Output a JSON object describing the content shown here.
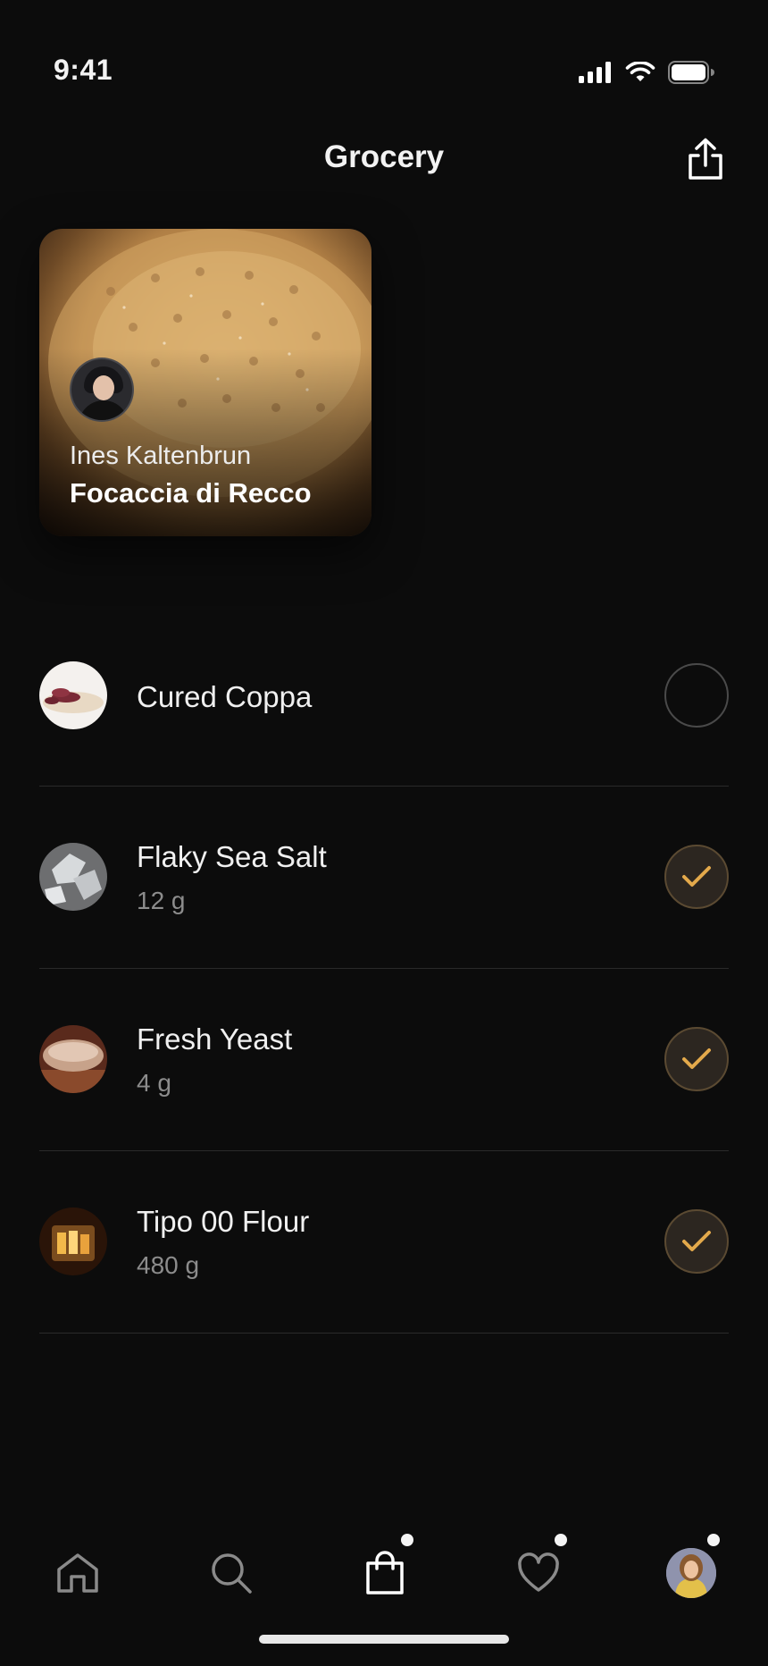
{
  "status_bar": {
    "time": "9:41"
  },
  "header": {
    "title": "Grocery"
  },
  "recipe": {
    "author": "Ines Kaltenbrun",
    "title": "Focaccia di Recco"
  },
  "items": [
    {
      "name": "Cured Coppa",
      "qty": "",
      "checked": false
    },
    {
      "name": "Flaky Sea Salt",
      "qty": "12 g",
      "checked": true
    },
    {
      "name": "Fresh Yeast",
      "qty": "4 g",
      "checked": true
    },
    {
      "name": "Tipo 00 Flour",
      "qty": "480 g",
      "checked": true
    }
  ],
  "tab_bar": {
    "tabs": [
      {
        "icon": "home-icon",
        "badge": false,
        "active": false
      },
      {
        "icon": "search-icon",
        "badge": false,
        "active": false
      },
      {
        "icon": "shopping-bag-icon",
        "badge": true,
        "active": true
      },
      {
        "icon": "heart-icon",
        "badge": true,
        "active": false
      },
      {
        "icon": "profile-avatar",
        "badge": true,
        "active": false
      }
    ]
  },
  "colors": {
    "background": "#0c0c0c",
    "accent": "#e3a94b",
    "divider": "#2a2a2a"
  }
}
